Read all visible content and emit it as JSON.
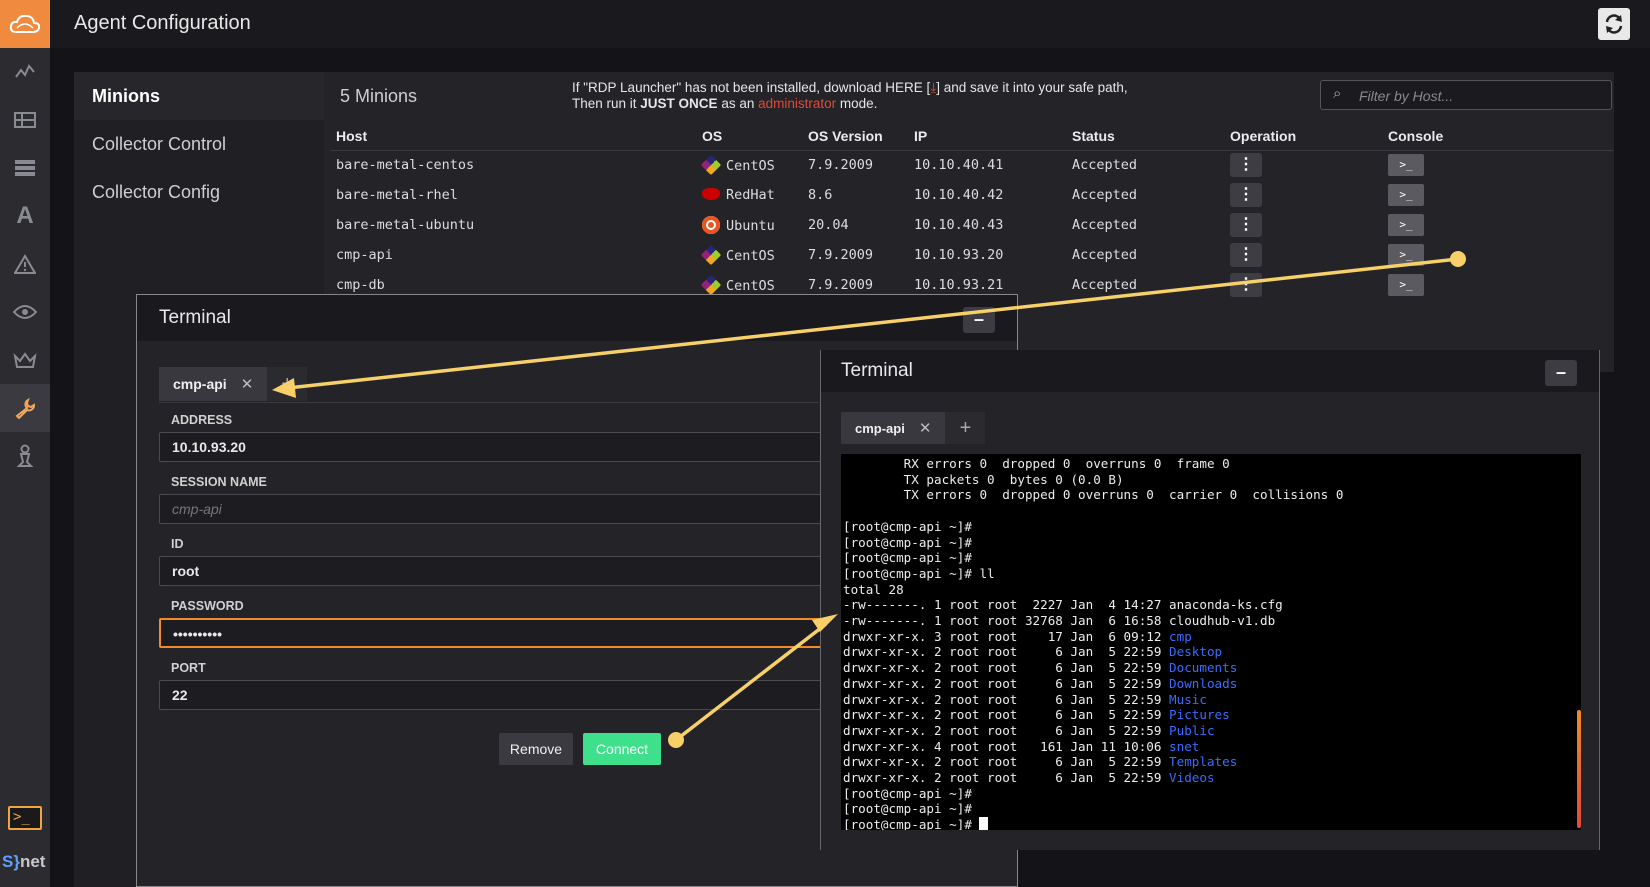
{
  "header": {
    "title": "Agent Configuration"
  },
  "subnav": {
    "items": [
      "Minions",
      "Collector Control",
      "Collector Config"
    ]
  },
  "main": {
    "count": "5 Minions",
    "notice_line1_pre": "If \"RDP Launcher\" has not been installed, download HERE [",
    "notice_line1_post": "] and save it into your safe path,",
    "notice_line2_pre": "Then run it ",
    "notice_line2_bold": "JUST ONCE",
    "notice_line2_mid": " as an ",
    "notice_line2_red": "administrator",
    "notice_line2_post": " mode.",
    "filter_placeholder": "Filter by Host..."
  },
  "table": {
    "headers": [
      "Host",
      "OS",
      "OS Version",
      "IP",
      "Status",
      "Operation",
      "Console"
    ],
    "rows": [
      {
        "host": "bare-metal-centos",
        "os": "CentOS",
        "os_icon": "centos-icon",
        "version": "7.9.2009",
        "ip": "10.10.40.41",
        "status": "Accepted"
      },
      {
        "host": "bare-metal-rhel",
        "os": "RedHat",
        "os_icon": "redhat-icon",
        "version": "8.6",
        "ip": "10.10.40.42",
        "status": "Accepted"
      },
      {
        "host": "bare-metal-ubuntu",
        "os": "Ubuntu",
        "os_icon": "ubuntu-icon",
        "version": "20.04",
        "ip": "10.10.40.43",
        "status": "Accepted"
      },
      {
        "host": "cmp-api",
        "os": "CentOS",
        "os_icon": "centos-icon",
        "version": "7.9.2009",
        "ip": "10.10.93.20",
        "status": "Accepted"
      },
      {
        "host": "cmp-db",
        "os": "CentOS",
        "os_icon": "centos-icon",
        "version": "7.9.2009",
        "ip": "10.10.93.21",
        "status": "Accepted"
      }
    ]
  },
  "terminal1": {
    "title": "Terminal",
    "tab": "cmp-api",
    "labels": {
      "address": "ADDRESS",
      "session": "SESSION NAME",
      "id": "ID",
      "password": "PASSWORD",
      "port": "PORT"
    },
    "values": {
      "address": "10.10.93.20",
      "session_placeholder": "cmp-api",
      "id": "root",
      "password": "••••••••••",
      "port": "22"
    },
    "remove": "Remove",
    "connect": "Connect"
  },
  "terminal2": {
    "title": "Terminal",
    "tab": "cmp-api",
    "lines": [
      "        RX errors 0  dropped 0  overruns 0  frame 0",
      "        TX packets 0  bytes 0 (0.0 B)",
      "        TX errors 0  dropped 0 overruns 0  carrier 0  collisions 0",
      "",
      "[root@cmp-api ~]#",
      "[root@cmp-api ~]#",
      "[root@cmp-api ~]#",
      "[root@cmp-api ~]# ll",
      "total 28"
    ],
    "listing": [
      {
        "perm": "-rw-------. 1 root root  2227 Jan  4 14:27 ",
        "name": "anaconda-ks.cfg",
        "dir": false
      },
      {
        "perm": "-rw-------. 1 root root 32768 Jan  6 16:58 ",
        "name": "cloudhub-v1.db",
        "dir": false
      },
      {
        "perm": "drwxr-xr-x. 3 root root    17 Jan  6 09:12 ",
        "name": "cmp",
        "dir": true
      },
      {
        "perm": "drwxr-xr-x. 2 root root     6 Jan  5 22:59 ",
        "name": "Desktop",
        "dir": true
      },
      {
        "perm": "drwxr-xr-x. 2 root root     6 Jan  5 22:59 ",
        "name": "Documents",
        "dir": true
      },
      {
        "perm": "drwxr-xr-x. 2 root root     6 Jan  5 22:59 ",
        "name": "Downloads",
        "dir": true
      },
      {
        "perm": "drwxr-xr-x. 2 root root     6 Jan  5 22:59 ",
        "name": "Music",
        "dir": true
      },
      {
        "perm": "drwxr-xr-x. 2 root root     6 Jan  5 22:59 ",
        "name": "Pictures",
        "dir": true
      },
      {
        "perm": "drwxr-xr-x. 2 root root     6 Jan  5 22:59 ",
        "name": "Public",
        "dir": true
      },
      {
        "perm": "drwxr-xr-x. 4 root root   161 Jan 11 10:06 ",
        "name": "snet",
        "dir": true
      },
      {
        "perm": "drwxr-xr-x. 2 root root     6 Jan  5 22:59 ",
        "name": "Templates",
        "dir": true
      },
      {
        "perm": "drwxr-xr-x. 2 root root     6 Jan  5 22:59 ",
        "name": "Videos",
        "dir": true
      }
    ],
    "tail": [
      "[root@cmp-api ~]#",
      "[root@cmp-api ~]#",
      "[root@cmp-api ~]# "
    ]
  },
  "sidebar": {
    "brand_s": "S",
    "brand_bracket": "}",
    "brand_net": "net",
    "term_glyph": ">_"
  },
  "colors": {
    "accent": "#f08a3e",
    "status_ok": "#3fe08c",
    "arrow": "#f7d06a",
    "dir": "#3a6cff"
  }
}
